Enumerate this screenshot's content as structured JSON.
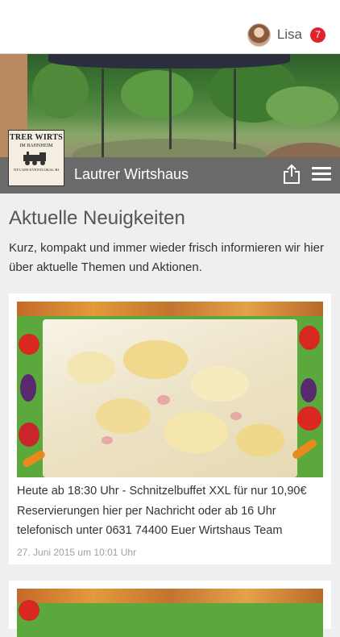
{
  "header": {
    "user_name": "Lisa",
    "notification_count": "7"
  },
  "app": {
    "title": "Lautrer Wirtshaus",
    "logo_line1": "TRER WIRTS",
    "logo_line2": "IM BAHNHEIM",
    "logo_line3": "NT-CAFE-EVENTLOKAL-BI"
  },
  "main": {
    "heading": "Aktuelle Neuigkeiten",
    "intro": "Kurz, kompakt und immer wieder frisch informieren wir hier über aktuelle Themen und Aktionen."
  },
  "news": [
    {
      "text": "Heute ab 18:30 Uhr - Schnitzelbuffet XXL für nur 10,90€ Reservierungen hier per Nachricht oder ab 16 Uhr telefonisch unter 0631 74400 Euer Wirtshaus Team",
      "date": "27. Juni 2015 um 10:01 Uhr"
    }
  ],
  "colors": {
    "title_bar": "#6a6a6a",
    "badge": "#e0232a",
    "background": "#efefef"
  },
  "icons": {
    "share": "share-icon",
    "menu": "menu-icon"
  }
}
